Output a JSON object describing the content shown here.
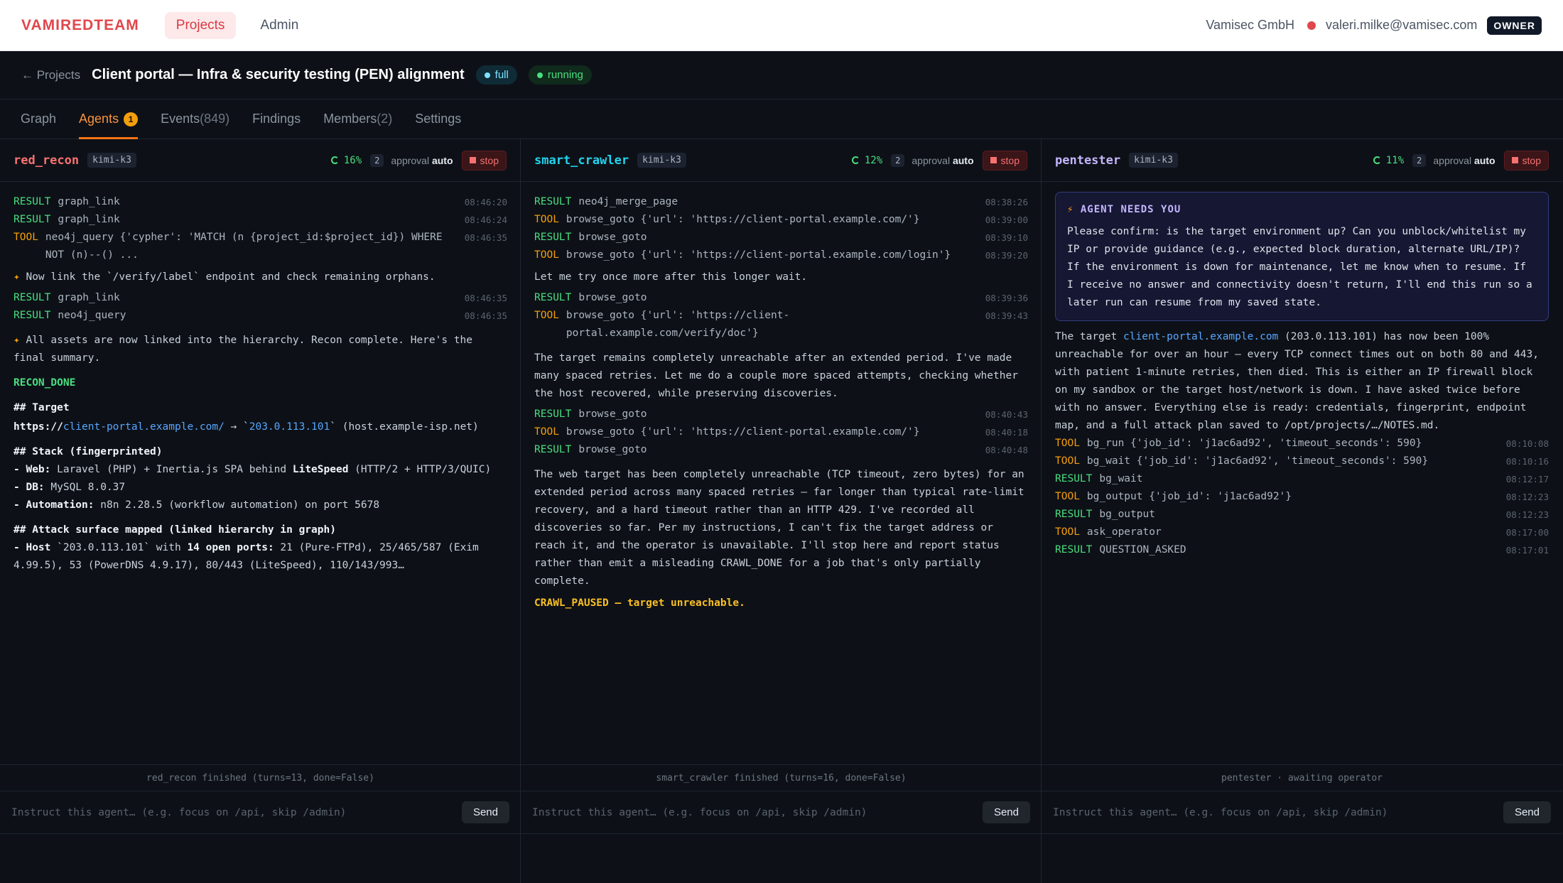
{
  "topbar": {
    "brand": "VAMIREDTEAM",
    "nav": [
      {
        "label": "Projects"
      },
      {
        "label": "Admin"
      }
    ],
    "org": "Vamisec GmbH",
    "email": "valeri.milke@vamisec.com",
    "role": "OWNER"
  },
  "project": {
    "back": "← Projects",
    "title": "Client portal — Infra & security testing (PEN) alignment",
    "mode": "full",
    "status": "running"
  },
  "tabs": [
    {
      "label": "Graph"
    },
    {
      "label": "Agents",
      "badge": "1"
    },
    {
      "label": "Events",
      "count": "(849)"
    },
    {
      "label": "Findings"
    },
    {
      "label": "Members",
      "count": "(2)"
    },
    {
      "label": "Settings"
    }
  ],
  "common": {
    "approval_label": "approval",
    "approval_value": "auto",
    "stop_label": "stop",
    "input_placeholder": "Instruct this agent… (e.g. focus on /api, skip /admin)",
    "send_label": "Send",
    "result": "RESULT",
    "tool": "TOOL"
  },
  "agents": [
    {
      "name": "red_recon",
      "model": "kimi-k3",
      "progress": "16%",
      "turns": "2",
      "color": "#f87171",
      "footer": "red_recon finished (turns=13, done=False)",
      "events": [
        {
          "kind": "RESULT",
          "text": "graph_link",
          "ts": "08:46:20"
        },
        {
          "kind": "RESULT",
          "text": "graph_link",
          "ts": "08:46:24"
        },
        {
          "kind": "TOOL",
          "text": "neo4j_query {'cypher': 'MATCH (n {project_id:$project_id}) WHERE NOT (n)--() ...",
          "ts": "08:46:35"
        }
      ],
      "note1": "Now link the `/verify/label` endpoint and check remaining orphans.",
      "events2": [
        {
          "kind": "RESULT",
          "text": "graph_link",
          "ts": "08:46:35"
        },
        {
          "kind": "RESULT",
          "text": "neo4j_query",
          "ts": "08:46:35"
        }
      ],
      "note2": "All assets are now linked into the hierarchy. Recon complete. Here's the final summary.",
      "done": "RECON_DONE",
      "h_target": "## Target",
      "target_prefix": "https://",
      "target_host": "client-portal.example.com/",
      "target_arrow": " → `",
      "target_ip": "203.0.113.101",
      "target_tail": "` (host.example-isp.net)",
      "h_stack": "## Stack (fingerprinted)",
      "stack": [
        {
          "k": "- Web:",
          "v": " Laravel (PHP) + Inertia.js SPA behind ",
          "b": "LiteSpeed",
          "t": " (HTTP/2 + HTTP/3/QUIC)"
        },
        {
          "k": "- DB:",
          "v": " MySQL 8.0.37",
          "b": "",
          "t": ""
        },
        {
          "k": "- Automation:",
          "v": " n8n 2.28.5 (workflow automation) on port 5678",
          "b": "",
          "t": ""
        }
      ],
      "h_attack": "## Attack surface mapped (linked hierarchy in graph)",
      "attack_k": "- Host",
      "attack_ip": " `203.0.113.101` with ",
      "attack_b": "14 open ports:",
      "attack_t": " 21 (Pure-FTPd), 25/465/587 (Exim 4.99.5), 53 (PowerDNS 4.9.17), 80/443 (LiteSpeed), 110/143/993…"
    },
    {
      "name": "smart_crawler",
      "model": "kimi-k3",
      "progress": "12%",
      "turns": "2",
      "color": "#22d3ee",
      "footer": "smart_crawler finished (turns=16, done=False)",
      "events": [
        {
          "kind": "RESULT",
          "text": "neo4j_merge_page",
          "ts": "08:38:26"
        },
        {
          "kind": "TOOL",
          "text": "browse_goto {'url': 'https://client-portal.example.com/'}",
          "ts": "08:39:00"
        },
        {
          "kind": "RESULT",
          "text": "browse_goto",
          "ts": "08:39:10"
        },
        {
          "kind": "TOOL",
          "text": "browse_goto {'url': 'https://client-portal.example.com/login'}",
          "ts": "08:39:20"
        }
      ],
      "note1": "Let me try once more after this longer wait.",
      "events2": [
        {
          "kind": "RESULT",
          "text": "browse_goto",
          "ts": "08:39:36"
        },
        {
          "kind": "TOOL",
          "text": "browse_goto {'url': 'https://client-portal.example.com/verify/doc'}",
          "ts": "08:39:43"
        }
      ],
      "note2": "The target remains completely unreachable after an extended period. I've made many spaced retries. Let me do a couple more spaced attempts, checking whether the host recovered, while preserving discoveries.",
      "events3": [
        {
          "kind": "RESULT",
          "text": "browse_goto",
          "ts": "08:40:43"
        },
        {
          "kind": "TOOL",
          "text": "browse_goto {'url': 'https://client-portal.example.com/'}",
          "ts": "08:40:18"
        },
        {
          "kind": "RESULT",
          "text": "browse_goto",
          "ts": "08:40:48"
        }
      ],
      "note3": "The web target has been completely unreachable (TCP timeout, zero bytes) for an extended period across many spaced retries — far longer than typical rate-limit recovery, and a hard timeout rather than an HTTP 429. I've recorded all discoveries so far. Per my instructions, I can't fix the target address or reach it, and the operator is unavailable. I'll stop here and report status rather than emit a misleading CRAWL_DONE for a job that's only partially complete.",
      "paused": "CRAWL_PAUSED — target unreachable."
    },
    {
      "name": "pentester",
      "model": "kimi-k3",
      "progress": "11%",
      "turns": "2",
      "color": "#c4b5fd",
      "footer": "pentester · awaiting operator",
      "needs_title": "AGENT NEEDS YOU",
      "needs_body": "Please confirm: is the target environment up? Can you unblock/whitelist my IP or provide guidance (e.g., expected block duration, alternate URL/IP)? If the environment is down for maintenance, let me know when to resume. If I receive no answer and connectivity doesn't return, I'll end this run so a later run can resume from my saved state.",
      "status_pre": "The target ",
      "status_host": "client-portal.example.com",
      "status_post": " (203.0.113.101) has now been 100% unreachable for over an hour — every TCP connect times out on both 80 and 443, with patient 1-minute retries, then died. This is either an IP firewall block on my sandbox or the target host/network is down. I have asked twice before with no answer. Everything else is ready: credentials, fingerprint, endpoint map, and a full attack plan saved to /opt/projects/…/NOTES.md.",
      "events": [
        {
          "kind": "TOOL",
          "text": "bg_run {'job_id': 'j1ac6ad92', 'timeout_seconds': 590}",
          "ts": "08:10:08"
        },
        {
          "kind": "TOOL",
          "text": "bg_wait {'job_id': 'j1ac6ad92', 'timeout_seconds': 590}",
          "ts": "08:10:16"
        },
        {
          "kind": "RESULT",
          "text": "bg_wait",
          "ts": "08:12:17"
        },
        {
          "kind": "TOOL",
          "text": "bg_output {'job_id': 'j1ac6ad92'}",
          "ts": "08:12:23"
        },
        {
          "kind": "RESULT",
          "text": "bg_output",
          "ts": "08:12:23"
        },
        {
          "kind": "TOOL",
          "text": "ask_operator",
          "ts": "08:17:00"
        },
        {
          "kind": "RESULT",
          "text": "QUESTION_ASKED",
          "ts": "08:17:01"
        }
      ]
    }
  ]
}
